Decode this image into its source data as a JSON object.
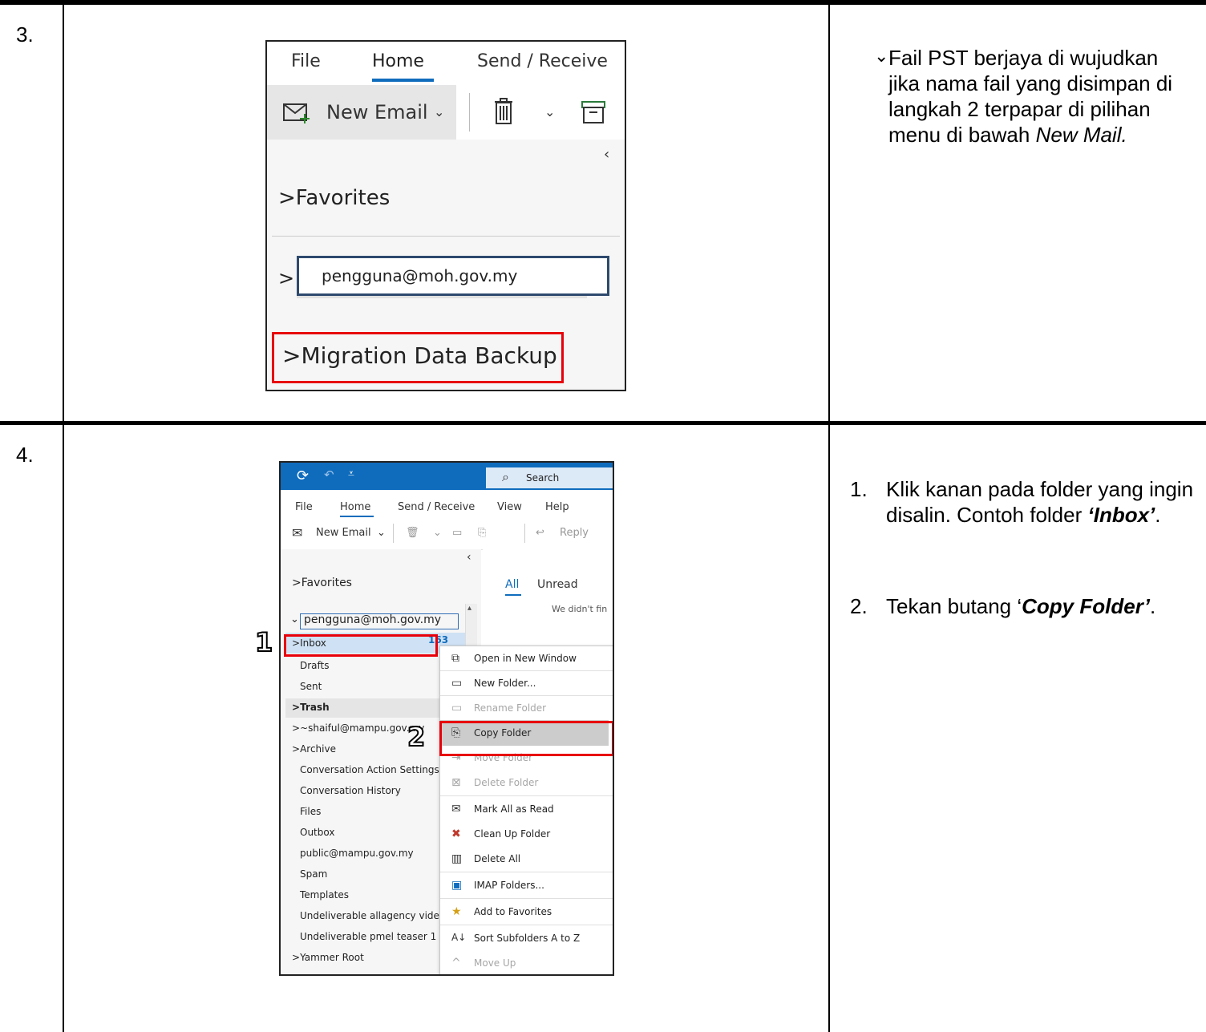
{
  "steps": [
    {
      "number": "3.",
      "description": "Fail PST berjaya di wujudkan jika nama fail yang disimpan di langkah 2 terpapar di pilihan menu di bawah",
      "description_italic": "New Mail.",
      "screenshot": {
        "tabs": [
          "File",
          "Home",
          "Send / Receive"
        ],
        "active_tab": "Home",
        "new_email_label": "New Email",
        "favorites_label": "Favorites",
        "account_email": "pengguna@moh.gov.my",
        "pst_folder": "Migration Data Backup"
      }
    },
    {
      "number": "4.",
      "instructions": [
        {
          "num": "1.",
          "text": "Klik kanan pada folder yang ingin disalin. Contoh folder",
          "emph": "‘Inbox’",
          "end": "."
        },
        {
          "num": "2.",
          "text": "Tekan butang ‘",
          "emph": "Copy Folder’",
          "end": "."
        }
      ],
      "screenshot": {
        "search_label": "Search",
        "tabs": [
          "File",
          "Home",
          "Send / Receive",
          "View",
          "Help"
        ],
        "active_tab": "Home",
        "new_email_label": "New Email",
        "reply_label": "Reply",
        "filter_tabs": [
          "All",
          "Unread"
        ],
        "empty_message": "We didn't fin",
        "favorites_label": "Favorites",
        "account_email": "pengguna@moh.gov.my",
        "inbox_count": "163",
        "folders": [
          "Inbox",
          "Drafts",
          "Sent",
          "Trash",
          "~shaiful@mampu.gov.my",
          "Archive",
          "Conversation Action Settings",
          "Conversation History",
          "Files",
          "Outbox",
          "public@mampu.gov.my",
          "Spam",
          "Templates",
          "Undeliverable allagency video.",
          "Undeliverable pmel teaser 1",
          "Yammer Root"
        ],
        "context_menu": [
          {
            "label": "Open in New Window",
            "enabled": true
          },
          {
            "label": "New Folder...",
            "enabled": true
          },
          {
            "label": "Rename Folder",
            "enabled": false
          },
          {
            "label": "Copy Folder",
            "enabled": true
          },
          {
            "label": "Move Folder",
            "enabled": false
          },
          {
            "label": "Delete Folder",
            "enabled": false
          },
          {
            "label": "Mark All as Read",
            "enabled": true
          },
          {
            "label": "Clean Up Folder",
            "enabled": true
          },
          {
            "label": "Delete All",
            "enabled": true
          },
          {
            "label": "IMAP Folders...",
            "enabled": true
          },
          {
            "label": "Add to Favorites",
            "enabled": true
          },
          {
            "label": "Sort Subfolders A to Z",
            "enabled": true
          },
          {
            "label": "Move Up",
            "enabled": false
          }
        ],
        "markers": [
          "1",
          "2"
        ]
      }
    }
  ],
  "colors": {
    "accent": "#0f6cbd",
    "highlight_red": "#e8000b"
  }
}
